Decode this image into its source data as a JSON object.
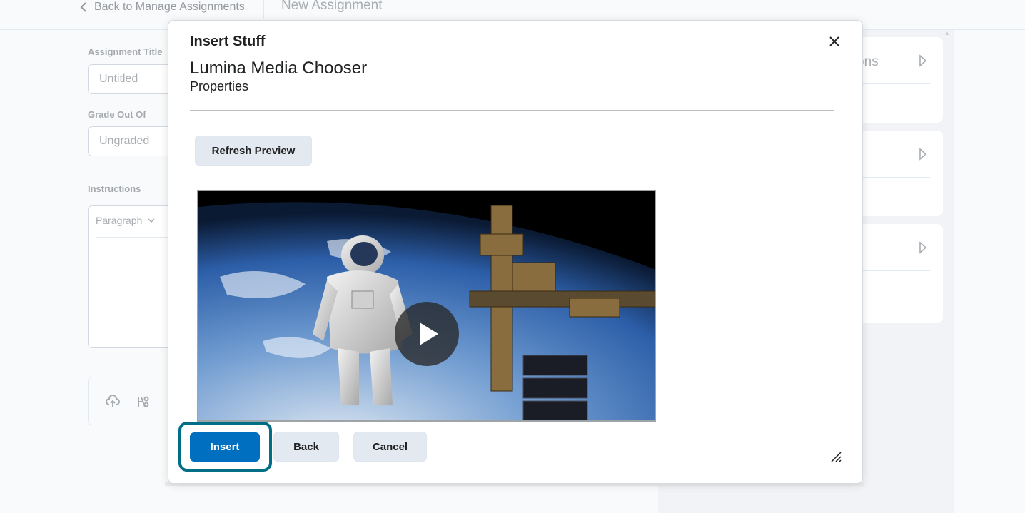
{
  "background_page": {
    "back_link": "Back to Manage Assignments",
    "page_title": "New Assignment",
    "assignment_title_label": "Assignment Title",
    "assignment_title_placeholder": "Untitled",
    "grade_label": "Grade Out Of",
    "grade_placeholder": "Ungraded",
    "instructions_label": "Instructions",
    "format_select": "Paragraph",
    "side_panel_partial_heading": "ons"
  },
  "modal": {
    "title": "Insert Stuff",
    "chooser_title": "Lumina Media Chooser",
    "chooser_subtitle": "Properties",
    "refresh_button": "Refresh Preview",
    "video": {
      "scene": "astronaut in space beside space station over Earth",
      "play_icon": "play-icon"
    },
    "buttons": {
      "insert": "Insert",
      "back": "Back",
      "cancel": "Cancel"
    },
    "close_icon": "close-icon",
    "resize_icon": "resize-handle-icon"
  },
  "colors": {
    "primary": "#006fbf",
    "focus_ring": "#006f86",
    "secondary_button": "#e3e9f1"
  }
}
